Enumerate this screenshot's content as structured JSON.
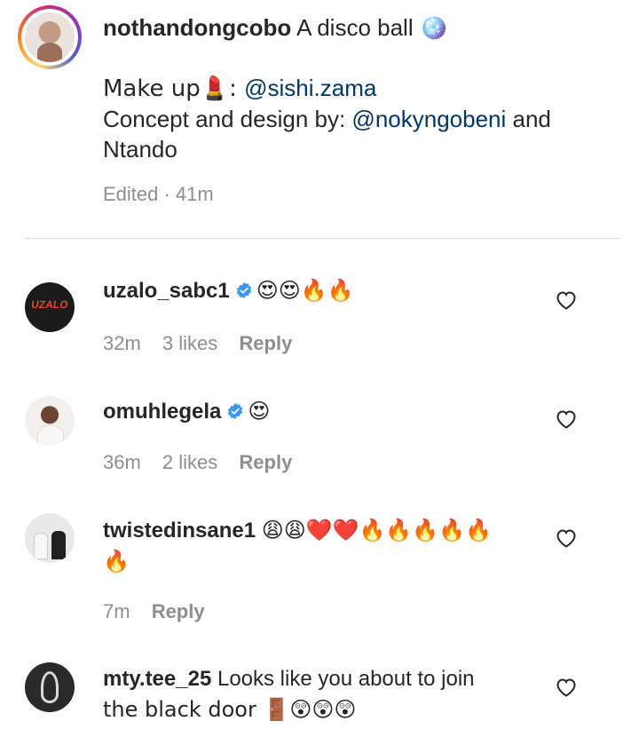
{
  "caption": {
    "username": "nothandongcobo",
    "text": "A disco ball 🪩",
    "makeup_label": "Make up💄: ",
    "makeup_mention": "@sishi.zama",
    "concept_label": "Concept and design by: ",
    "concept_mention": "@nokyngobeni",
    "concept_tail": " and",
    "concept_tail2": "Ntando",
    "edited": "Edited · 41m"
  },
  "comments": [
    {
      "username": "uzalo_sabc1",
      "verified": true,
      "text": "😍😍🔥🔥",
      "avatar_text": "UZALO",
      "time": "32m",
      "likes": "3 likes",
      "reply": "Reply"
    },
    {
      "username": "omuhlegela",
      "verified": true,
      "text": "😍",
      "time": "36m",
      "likes": "2 likes",
      "reply": "Reply"
    },
    {
      "username": "twistedinsane1",
      "verified": false,
      "text": "😩😩❤️❤️🔥🔥🔥🔥🔥",
      "text2": "🔥",
      "time": "7m",
      "reply": "Reply"
    },
    {
      "username": "mty.tee_25",
      "verified": false,
      "text": "Looks like you about to join",
      "text2": "the black door 🚪😲😲😲"
    }
  ],
  "colors": {
    "text": "#262626",
    "meta": "#8e8e8e",
    "mention": "#00376b",
    "verified": "#3897f0",
    "divider": "#dbdbdb"
  },
  "icons": [
    "heart-icon",
    "verified-badge-icon"
  ]
}
